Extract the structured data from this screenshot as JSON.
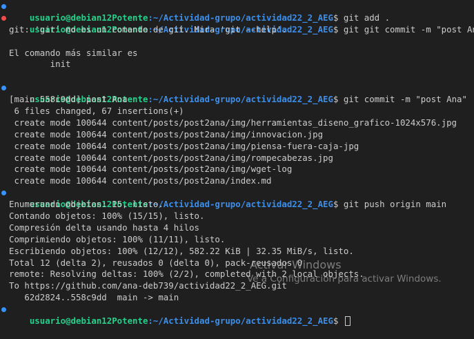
{
  "prompt": {
    "user": "usuario@debian12Potente",
    "path": ":~/Actividad-grupo/actividad22_2_AEG",
    "symbol": "$"
  },
  "commands": {
    "c1": " git add .",
    "c2": " git git commit -m \"post Ana\"",
    "c3": " git commit -m \"post Ana\"",
    "c4": " git push origin main",
    "c5": " "
  },
  "output": {
    "err1": "git: 'git' no es un comando de git. Mira 'git --help'.",
    "blank": "",
    "err2": "El comando más similar es",
    "err3": "        init",
    "commit1": "[main 558c9dd] post Ana",
    "commit2": " 6 files changed, 67 insertions(+)",
    "commit3": " create mode 100644 content/posts/post2ana/img/herramientas_diseno_grafico-1024x576.jpg",
    "commit4": " create mode 100644 content/posts/post2ana/img/innovacion.jpg",
    "commit5": " create mode 100644 content/posts/post2ana/img/piensa-fuera-caja-jpg",
    "commit6": " create mode 100644 content/posts/post2ana/img/rompecabezas.jpg",
    "commit7": " create mode 100644 content/posts/post2ana/img/wget-log",
    "commit8": " create mode 100644 content/posts/post2ana/index.md",
    "push1": "Enumerando objetos: 15, listo.",
    "push2": "Contando objetos: 100% (15/15), listo.",
    "push3": "Compresión delta usando hasta 4 hilos",
    "push4": "Comprimiendo objetos: 100% (11/11), listo.",
    "push5": "Escribiendo objetos: 100% (12/12), 582.22 KiB | 32.35 MiB/s, listo.",
    "push6": "Total 12 (delta 2), reusados 0 (delta 0), pack-reusados 0",
    "push7": "remote: Resolving deltas: 100% (2/2), completed with 2 local objects.",
    "push8": "To https://github.com/ana-deb739/actividad22_2_AEG.git",
    "push9": "   62d2824..558c9dd  main -> main"
  },
  "watermark": {
    "title": "Activar Windows",
    "subtitle": "Ve a Configuración para activar Windows."
  },
  "colors": {
    "background": "#1f1f1f",
    "text": "#cccccc",
    "user": "#23d18b",
    "path": "#3b8eea",
    "dot_ok": "#3794ff",
    "dot_err": "#f14c4c"
  }
}
